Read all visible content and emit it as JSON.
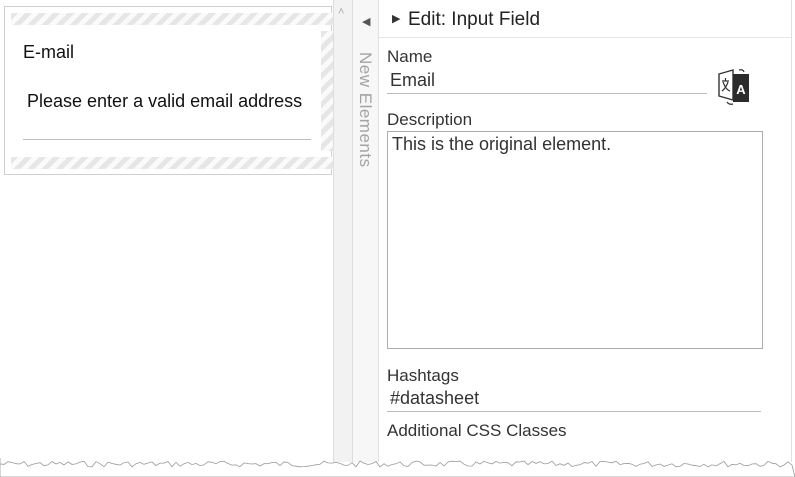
{
  "canvas": {
    "element": {
      "label": "E-mail",
      "value": "Please enter a valid email address"
    }
  },
  "palette": {
    "title": "New Elements"
  },
  "panel": {
    "title": "Edit: Input Field",
    "name": {
      "label": "Name",
      "value": "Email"
    },
    "translate_icon": "translate-icon",
    "description": {
      "label": "Description",
      "value": "This is the original element."
    },
    "hashtags": {
      "label": "Hashtags",
      "value": "#datasheet"
    },
    "css_classes": {
      "label": "Additional CSS Classes"
    }
  },
  "colors": {
    "border": "#cfcfcf",
    "palette_text": "#a3a3a3",
    "stripe": "#e6e6e6"
  }
}
